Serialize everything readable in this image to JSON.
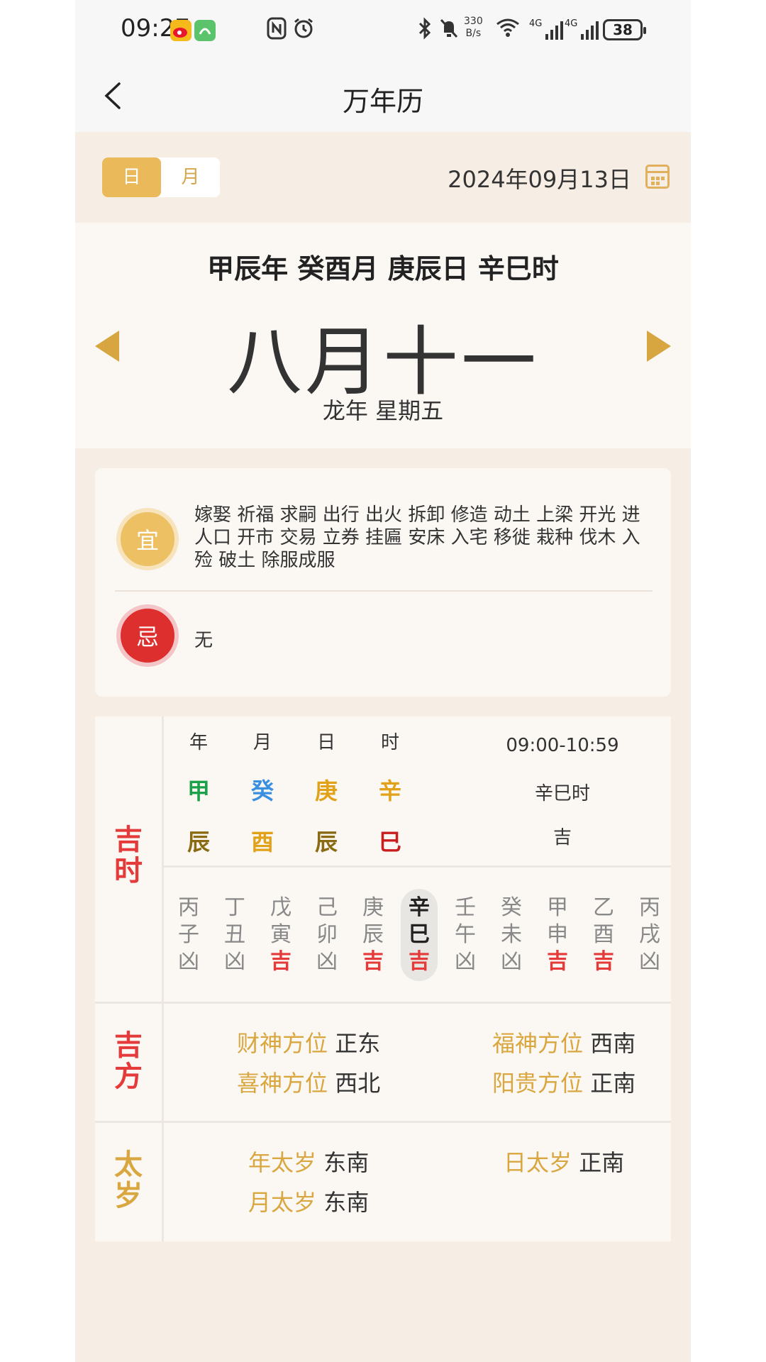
{
  "status_bar": {
    "time": "09:27",
    "net_speed_value": "330",
    "net_speed_unit": "B/s",
    "sig1_label": "4G",
    "sig2_label": "4G",
    "battery": "38",
    "icons": [
      "weibo-app-icon",
      "green-app-icon",
      "nfc-icon",
      "alarm-icon",
      "bluetooth-icon",
      "mute-icon",
      "wifi-icon",
      "signal-icon",
      "battery-icon"
    ]
  },
  "nav": {
    "title": "万年历",
    "back_icon": "chevron-left-icon"
  },
  "mode": {
    "day": "日",
    "month": "月",
    "selected": "day"
  },
  "date": {
    "text": "2024年09月13日",
    "icon": "calendar-icon"
  },
  "lunar": {
    "ganzhi": "甲辰年 癸酉月 庚辰日 辛巳时",
    "day": "八月十一",
    "sub": "龙年  星期五"
  },
  "almanac": {
    "yi_label": "宜",
    "yi": "嫁娶 祈福 求嗣 出行 出火 拆卸 修造 动土 上梁 开光 进人口 开市 交易 立券 挂匾 安床 入宅 移徙 栽种 伐木 入殓 破土 除服成服",
    "ji_label": "忌",
    "ji": "无"
  },
  "jishi": {
    "label": "吉时",
    "pillars": [
      {
        "head": "年",
        "stem": "甲",
        "branch": "辰",
        "stem_color": "#1aa14a",
        "branch_color": "#8a6a12"
      },
      {
        "head": "月",
        "stem": "癸",
        "branch": "酉",
        "stem_color": "#3a8fe0",
        "branch_color": "#e1a21a"
      },
      {
        "head": "日",
        "stem": "庚",
        "branch": "辰",
        "stem_color": "#e1a21a",
        "branch_color": "#8a6a12"
      },
      {
        "head": "时",
        "stem": "辛",
        "branch": "巳",
        "stem_color": "#e1a21a",
        "branch_color": "#c81e1e"
      }
    ],
    "hour_range": "09:00-10:59",
    "hour_name": "辛巳时",
    "hour_luck": "吉",
    "hours": [
      {
        "stem": "丙",
        "branch": "子",
        "luck": "凶"
      },
      {
        "stem": "丁",
        "branch": "丑",
        "luck": "凶"
      },
      {
        "stem": "戊",
        "branch": "寅",
        "luck": "吉"
      },
      {
        "stem": "己",
        "branch": "卯",
        "luck": "凶"
      },
      {
        "stem": "庚",
        "branch": "辰",
        "luck": "吉"
      },
      {
        "stem": "辛",
        "branch": "巳",
        "luck": "吉",
        "current": true
      },
      {
        "stem": "壬",
        "branch": "午",
        "luck": "凶"
      },
      {
        "stem": "癸",
        "branch": "未",
        "luck": "凶"
      },
      {
        "stem": "甲",
        "branch": "申",
        "luck": "吉"
      },
      {
        "stem": "乙",
        "branch": "酉",
        "luck": "吉"
      },
      {
        "stem": "丙",
        "branch": "戌",
        "luck": "凶"
      }
    ]
  },
  "jifang": {
    "label": "吉方",
    "items": [
      {
        "k": "财神方位",
        "v": "正东"
      },
      {
        "k": "福神方位",
        "v": "西南"
      },
      {
        "k": "喜神方位",
        "v": "西北"
      },
      {
        "k": "阳贵方位",
        "v": "正南"
      }
    ]
  },
  "taisui": {
    "label": "太岁",
    "items": [
      {
        "k": "年太岁",
        "v": "东南"
      },
      {
        "k": "日太岁",
        "v": "正南"
      },
      {
        "k": "月太岁",
        "v": "东南"
      }
    ]
  },
  "colors": {
    "accent": "#e9b95a",
    "good": "#e53a3a",
    "bg": "#f6eee4"
  }
}
